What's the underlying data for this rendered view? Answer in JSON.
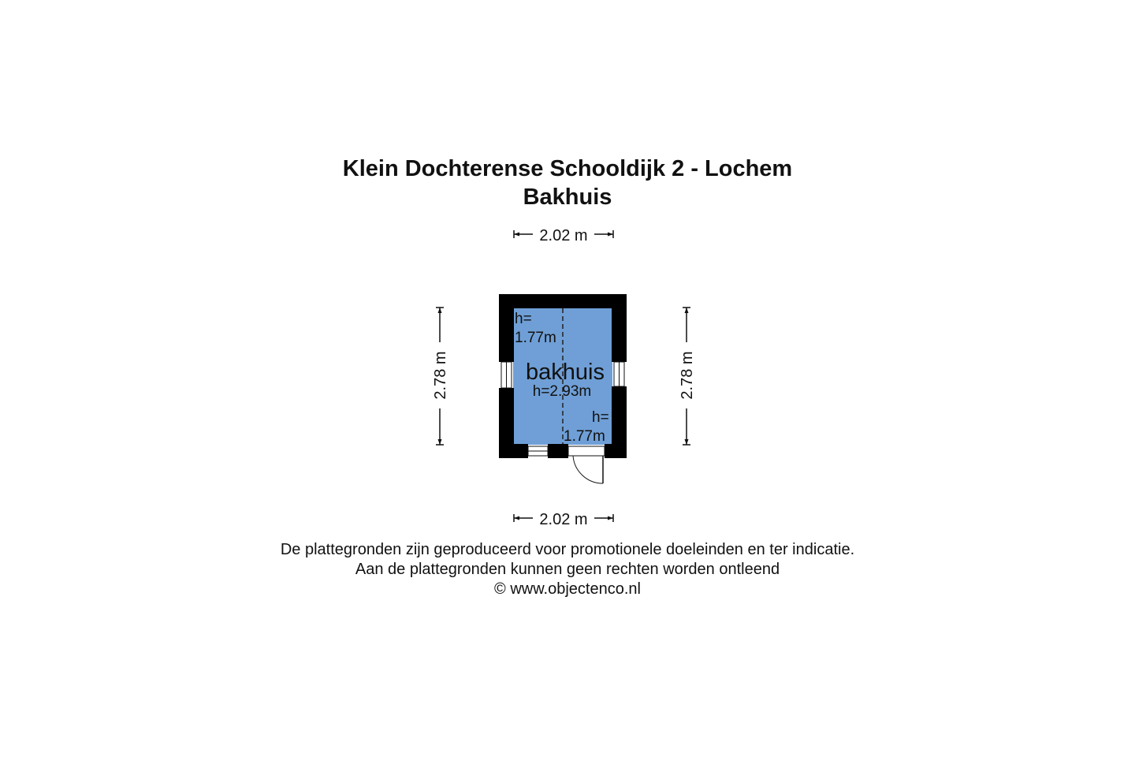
{
  "header": {
    "address": "Klein Dochterense Schooldijk 2 - Lochem",
    "building": "Bakhuis"
  },
  "dimensions": {
    "top_width": "2.02 m",
    "bottom_width": "2.02 m",
    "left_depth": "2.78 m",
    "right_depth": "2.78 m"
  },
  "room": {
    "name": "bakhuis",
    "center_height": "h=2.93m",
    "eave_height_left_line1": "h=",
    "eave_height_left_line2": "1.77m",
    "eave_height_right_line1": "h=",
    "eave_height_right_line2": "1.77m"
  },
  "footer": {
    "line1": "De plattegronden zijn geproduceerd voor promotionele doeleinden en ter indicatie.",
    "line2": "Aan de plattegronden kunnen geen rechten worden ontleend",
    "line3": "© www.objectenco.nl"
  },
  "colors": {
    "wall": "#000000",
    "floor": "#6f9fd6",
    "text": "#111111",
    "background": "#ffffff"
  }
}
